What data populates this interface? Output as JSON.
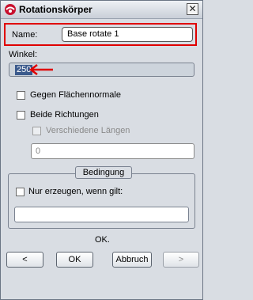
{
  "window": {
    "title": "Rotationskörper",
    "close_glyph": "✕"
  },
  "name": {
    "label": "Name:",
    "value": "Base rotate 1"
  },
  "angle": {
    "label": "Winkel:",
    "value": "250"
  },
  "options": {
    "normal": {
      "label": "Gegen Flächennormale",
      "checked": false
    },
    "both_directions": {
      "label": "Beide Richtungen",
      "checked": false
    },
    "different_lengths": {
      "label": "Verschiedene Längen",
      "checked": false,
      "enabled": false
    },
    "length_value": "0"
  },
  "condition": {
    "title": "Bedingung",
    "only_if_label": "Nur erzeugen, wenn gilt:",
    "checked": false,
    "value": ""
  },
  "status": "OK.",
  "buttons": {
    "prev": "<",
    "ok": "OK",
    "cancel": "Abbruch",
    "next": ">"
  },
  "colors": {
    "highlight_red": "#e00000",
    "selection_blue": "#3b5a8c"
  }
}
